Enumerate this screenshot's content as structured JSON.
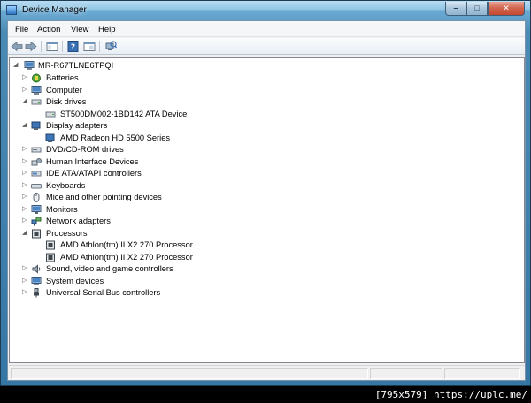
{
  "window": {
    "title": "Device Manager",
    "caption": {
      "minimize": "–",
      "maximize": "□",
      "close": "✕"
    }
  },
  "menu": {
    "items": [
      "File",
      "Action",
      "View",
      "Help"
    ]
  },
  "toolbar": {
    "buttons": [
      "back-icon",
      "forward-icon",
      "properties-icon",
      "help-icon",
      "console-icon",
      "scan-hardware-icon"
    ]
  },
  "tree": {
    "root": "MR-R67TLNE6TPQI",
    "categories": [
      {
        "label": "Batteries",
        "icon": "battery-icon",
        "expanded": false
      },
      {
        "label": "Computer",
        "icon": "computer-icon",
        "expanded": false
      },
      {
        "label": "Disk drives",
        "icon": "disk-drive-icon",
        "expanded": true,
        "children": [
          "ST500DM002-1BD142 ATA Device"
        ]
      },
      {
        "label": "Display adapters",
        "icon": "display-adapter-icon",
        "expanded": true,
        "children": [
          "AMD Radeon HD 5500 Series"
        ]
      },
      {
        "label": "DVD/CD-ROM drives",
        "icon": "dvd-drive-icon",
        "expanded": false
      },
      {
        "label": "Human Interface Devices",
        "icon": "hid-icon",
        "expanded": false
      },
      {
        "label": "IDE ATA/ATAPI controllers",
        "icon": "ide-controller-icon",
        "expanded": false
      },
      {
        "label": "Keyboards",
        "icon": "keyboard-icon",
        "expanded": false
      },
      {
        "label": "Mice and other pointing devices",
        "icon": "mouse-icon",
        "expanded": false
      },
      {
        "label": "Monitors",
        "icon": "monitor-icon",
        "expanded": false
      },
      {
        "label": "Network adapters",
        "icon": "network-adapter-icon",
        "expanded": false
      },
      {
        "label": "Processors",
        "icon": "processor-icon",
        "expanded": true,
        "children": [
          "AMD Athlon(tm) II X2 270 Processor",
          "AMD Athlon(tm) II X2 270 Processor"
        ]
      },
      {
        "label": "Sound, video and game controllers",
        "icon": "sound-icon",
        "expanded": false
      },
      {
        "label": "System devices",
        "icon": "system-device-icon",
        "expanded": false
      },
      {
        "label": "Universal Serial Bus controllers",
        "icon": "usb-icon",
        "expanded": false
      }
    ]
  },
  "watermark": "[795x579] https://uplc.me/",
  "colors": {
    "selection": "#3399ff",
    "titlebar": "#6aa9d2",
    "close": "#c44932"
  }
}
